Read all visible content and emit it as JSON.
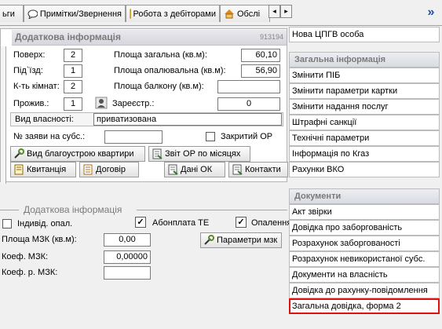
{
  "tabs": [
    {
      "label": "ьги"
    },
    {
      "label": "Примітки/Звернення"
    },
    {
      "label": "Робота з дебіторами"
    },
    {
      "label": "Обслі"
    }
  ],
  "tab_nav": {
    "prev": "◂",
    "next": "▸",
    "more": "»"
  },
  "extra_info": {
    "title": "Додаткова інформація",
    "code": "913194",
    "floor_label": "Поверх:",
    "floor_value": "2",
    "entrance_label": "Під`їзд:",
    "entrance_value": "1",
    "rooms_label": "К-ть кімнат:",
    "rooms_value": "2",
    "residents_label": "Прожив.:",
    "residents_value": "1",
    "area_total_label": "Площа загальна (кв.м):",
    "area_total_value": "60,10",
    "area_heated_label": "Площа опалювальна (кв.м):",
    "area_heated_value": "56,90",
    "area_balcony_label": "Площа балкону (кв.м):",
    "area_balcony_value": "",
    "registered_label": "Зареєстр.:",
    "registered_value": "0",
    "ownership_label": "Вид власності:",
    "ownership_value": "приватизована",
    "subsidy_label": "№ заяви на субс.:",
    "subsidy_value": "",
    "closed_label": "Закритий ОР",
    "btn_improvement": "Вид благоустрою квартири",
    "btn_report": "Звіт ОР по місяцях",
    "btn_receipt": "Квитанція",
    "btn_contract": "Договір",
    "btn_data": "Дані ОК",
    "btn_contacts": "Контакти"
  },
  "extra_info2": {
    "title": "Додаткова інформація",
    "individual_heating": "Індивід. опал.",
    "subscription_te": "Абонплата ТЕ",
    "heating": "Опалення",
    "mzk_area_label": "Площа МЗК (кв.м):",
    "mzk_area_value": "0,00",
    "mzk_coef_label": "Коеф. МЗК:",
    "mzk_coef_value": "0,00000",
    "mzk_r_coef_label": "Коеф. р. МЗК:",
    "mzk_r_coef_value": "",
    "btn_mzk_params": "Параметри мзк"
  },
  "right_panel": {
    "top_item": "Нова ЦПГВ особа",
    "general_header": "Загальна інформація",
    "general_items": [
      "Змінити ПІБ",
      "Змінити параметри картки",
      "Змінити надання послуг",
      "Штрафні санкції",
      "Технічні параметри",
      "Інформація по Кгаз",
      "Рахунки ВКО"
    ],
    "docs_header": "Документи",
    "docs_items": [
      "Акт звірки",
      "Довідка про заборгованість",
      "Розрахунок заборгованості",
      "Розрахунок невикористаної субс.",
      "Документи на власність",
      "Довідка до рахунку-повідомлення",
      "Загальна довідка, форма 2"
    ]
  }
}
